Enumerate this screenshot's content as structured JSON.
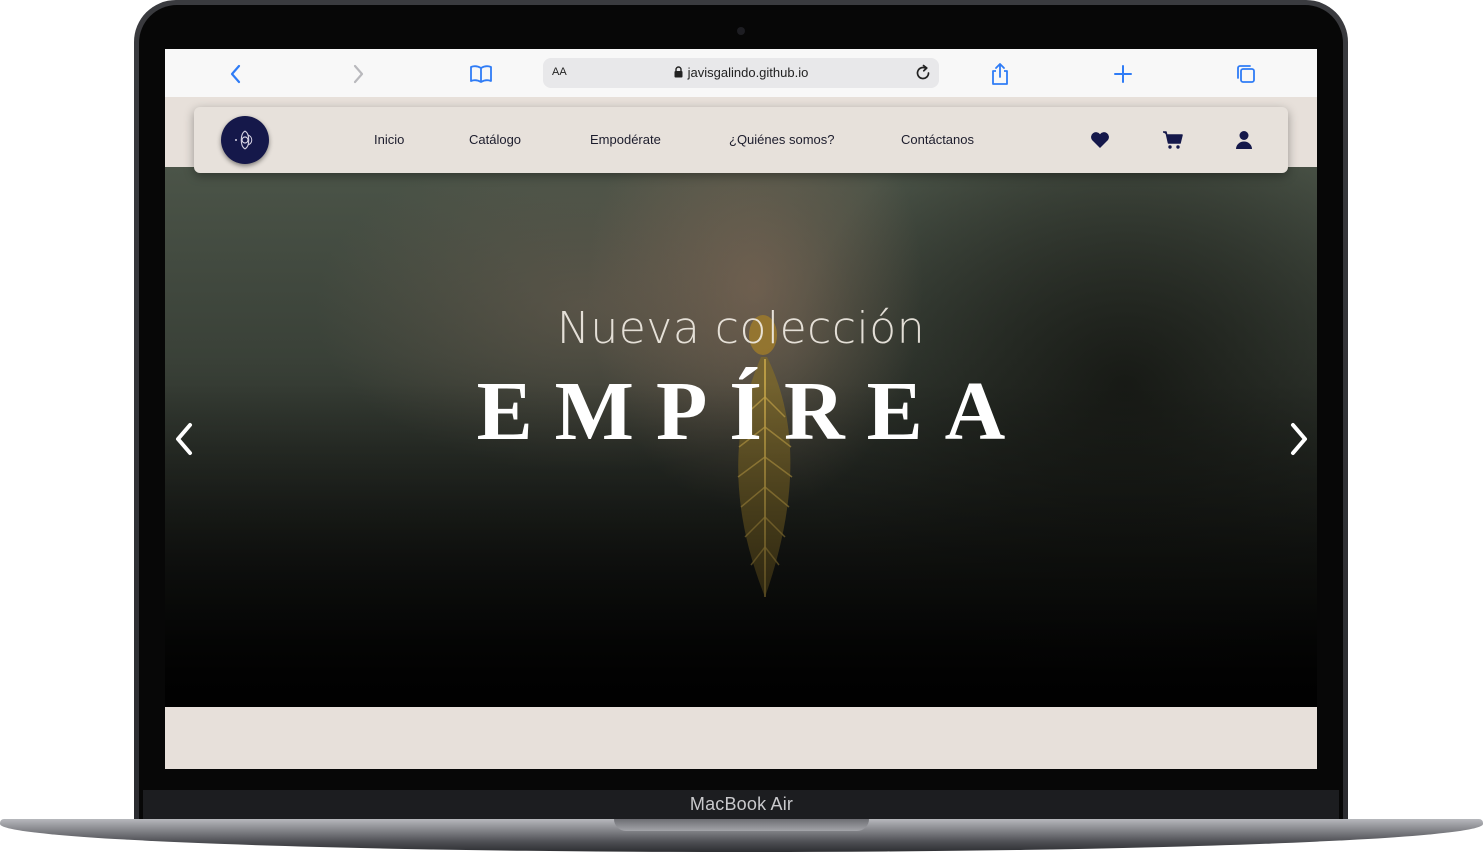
{
  "device": {
    "label": "MacBook Air"
  },
  "browser": {
    "address": {
      "reader_label": "AA",
      "url": "javisgalindo.github.io"
    }
  },
  "nav": {
    "items": [
      "Inicio",
      "Catálogo",
      "Empodérate",
      "¿Quiénes somos?",
      "Contáctanos"
    ],
    "icons": [
      "heart-icon",
      "cart-icon",
      "user-icon"
    ]
  },
  "hero": {
    "subtitle": "Nueva colección",
    "title": "EMPÍREA"
  },
  "colors": {
    "brand_navy": "#15184a",
    "nav_bg": "#e7e1db",
    "safari_blue": "#2f7cf6"
  }
}
